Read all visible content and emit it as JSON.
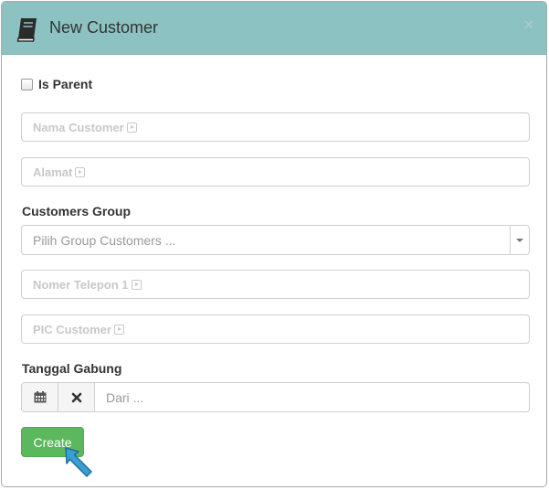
{
  "dialog": {
    "title": "New Customer",
    "close_label": "×",
    "title_icon": "book-icon"
  },
  "form": {
    "is_parent_label": "Is Parent",
    "is_parent_checked": false,
    "nama_customer_placeholder": "Nama Customer",
    "alamat_placeholder": "Alamat",
    "customers_group_label": "Customers Group",
    "customers_group_placeholder": "Pilih Group Customers ...",
    "nomer_telepon_placeholder": "Nomer Telepon 1",
    "pic_customer_placeholder": "PIC Customer",
    "tanggal_gabung_label": "Tanggal Gabung",
    "date_placeholder": "Dari  ...",
    "create_label": "Create"
  },
  "colors": {
    "header_bg": "#8cc2c2",
    "button_green": "#5cb85c",
    "cursor_blue": "#3a9fd4"
  }
}
